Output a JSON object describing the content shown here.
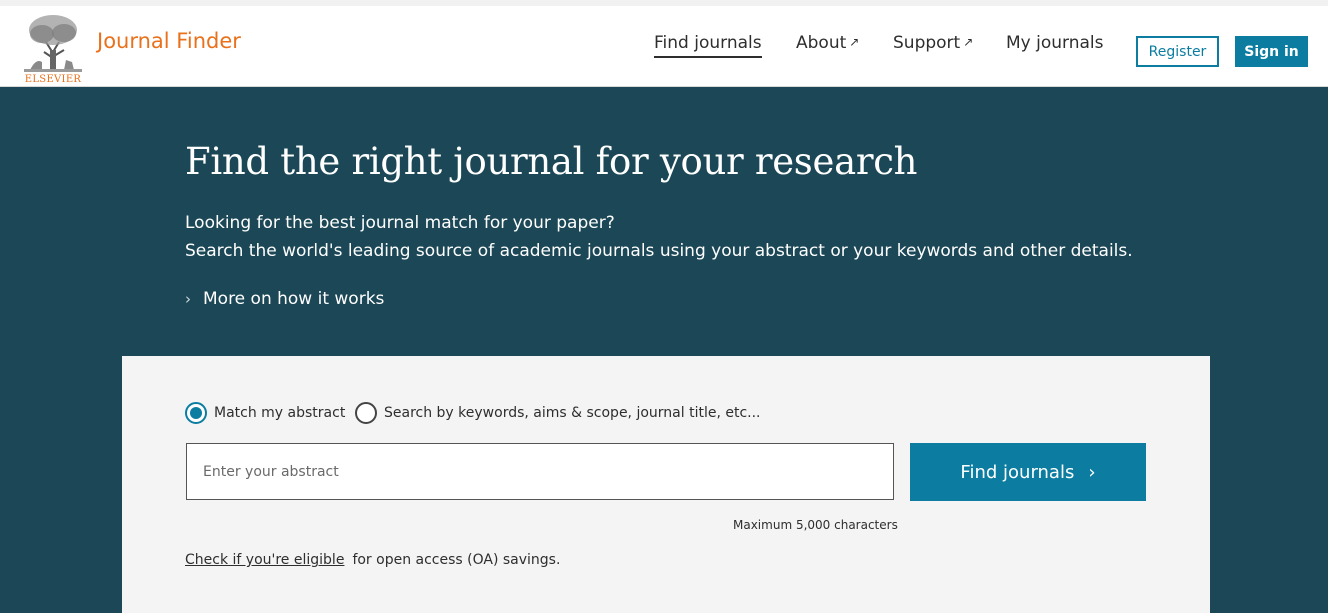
{
  "header": {
    "logo_wordmark": "ELSEVIER",
    "app_title": "Journal Finder",
    "nav": [
      {
        "label": "Find journals",
        "external": false,
        "active": true
      },
      {
        "label": "About",
        "external": true,
        "active": false
      },
      {
        "label": "Support",
        "external": true,
        "active": false
      },
      {
        "label": "My journals",
        "external": false,
        "active": false
      }
    ],
    "external_glyph": "↗",
    "register_label": "Register",
    "signin_label": "Sign in"
  },
  "hero": {
    "title": "Find the right journal for your research",
    "line1": "Looking for the best journal match for your paper?",
    "line2": "Search the world's leading source of academic journals using your abstract or your keywords and other details.",
    "more_link": "More on how it works",
    "more_chevron": "›"
  },
  "search": {
    "options": [
      {
        "label": "Match my abstract",
        "selected": true
      },
      {
        "label": "Search by keywords, aims & scope, journal title, etc...",
        "selected": false
      }
    ],
    "input_placeholder": "Enter your abstract",
    "input_value": "",
    "button_label": "Find journals",
    "button_chevron": "›",
    "max_chars": "Maximum 5,000 characters",
    "oa_link": "Check if you're eligible",
    "oa_text": "for open access (OA) savings."
  },
  "colors": {
    "brand_orange": "#e9711c",
    "hero_bg": "#1b4756",
    "accent_blue": "#0c7da1",
    "panel_bg": "#f4f4f4"
  }
}
